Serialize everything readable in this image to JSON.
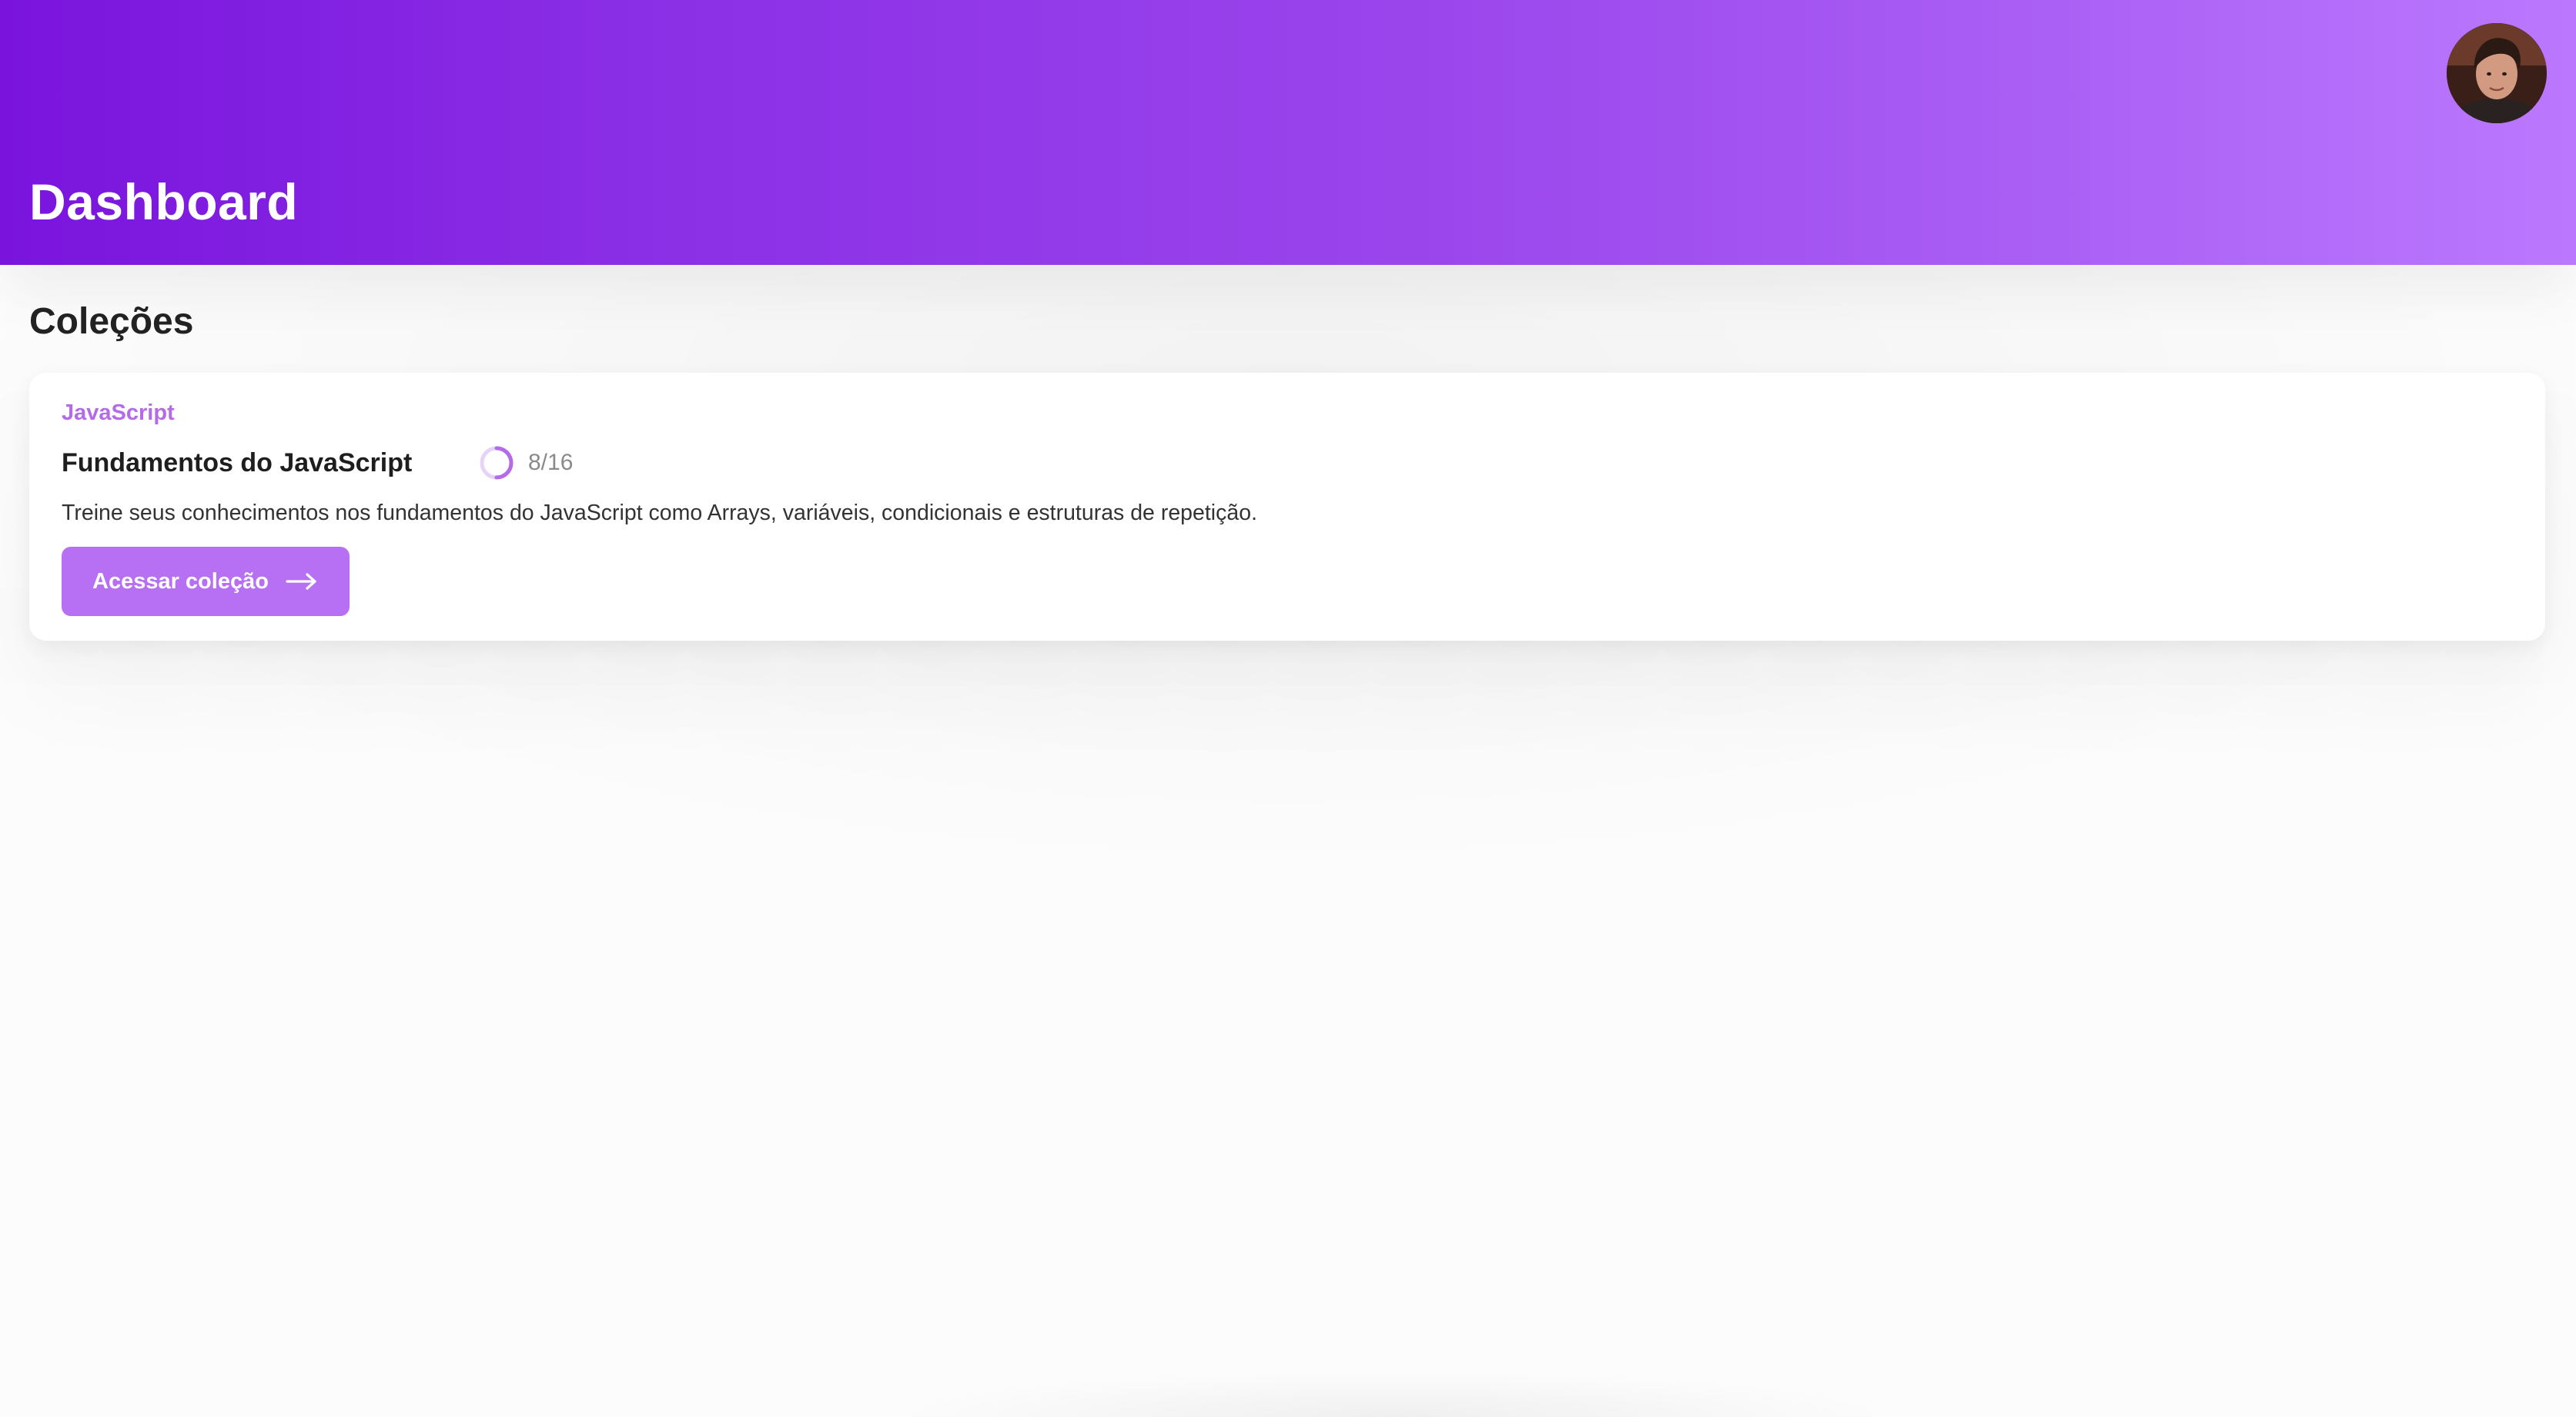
{
  "header": {
    "title": "Dashboard",
    "avatar_icon": "user-avatar-photo"
  },
  "main": {
    "section_title": "Coleções",
    "collections": [
      {
        "category": "JavaScript",
        "title": "Fundamentos do JavaScript",
        "progress_text": "8/16",
        "progress_fraction": 0.5,
        "description": "Treine seus conhecimentos nos fundamentos do JavaScript como Arrays, variáveis, condicionais e estruturas de repetição.",
        "button_label": "Acessar coleção",
        "button_icon": "arrow-right-icon"
      }
    ]
  },
  "colors": {
    "header_gradient_start": "#7a14dd",
    "header_gradient_end": "#bb78fe",
    "accent": "#b76ff4",
    "category_text": "#b46be8",
    "progress_ring": "#b46be8",
    "background": "#fcfcfc"
  }
}
